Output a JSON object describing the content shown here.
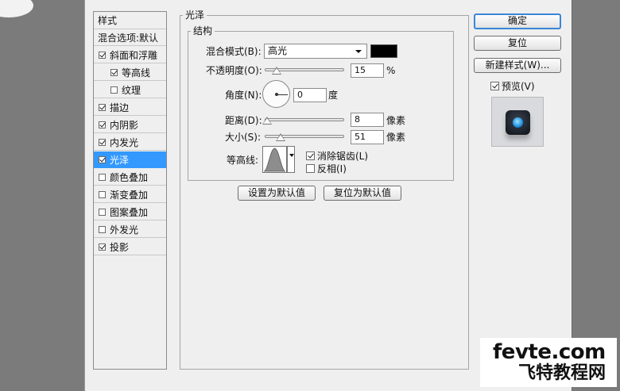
{
  "list": {
    "header": "样式",
    "items": [
      {
        "label": "混合选项:默认",
        "checkbox": false,
        "checked": false,
        "indent": false,
        "selected": false
      },
      {
        "label": "斜面和浮雕",
        "checkbox": true,
        "checked": true,
        "indent": false,
        "selected": false
      },
      {
        "label": "等高线",
        "checkbox": true,
        "checked": true,
        "indent": true,
        "selected": false
      },
      {
        "label": "纹理",
        "checkbox": true,
        "checked": false,
        "indent": true,
        "selected": false
      },
      {
        "label": "描边",
        "checkbox": true,
        "checked": true,
        "indent": false,
        "selected": false
      },
      {
        "label": "内阴影",
        "checkbox": true,
        "checked": true,
        "indent": false,
        "selected": false
      },
      {
        "label": "内发光",
        "checkbox": true,
        "checked": true,
        "indent": false,
        "selected": false
      },
      {
        "label": "光泽",
        "checkbox": true,
        "checked": true,
        "indent": false,
        "selected": true
      },
      {
        "label": "颜色叠加",
        "checkbox": true,
        "checked": false,
        "indent": false,
        "selected": false
      },
      {
        "label": "渐变叠加",
        "checkbox": true,
        "checked": false,
        "indent": false,
        "selected": false
      },
      {
        "label": "图案叠加",
        "checkbox": true,
        "checked": false,
        "indent": false,
        "selected": false
      },
      {
        "label": "外发光",
        "checkbox": true,
        "checked": false,
        "indent": false,
        "selected": false
      },
      {
        "label": "投影",
        "checkbox": true,
        "checked": true,
        "indent": false,
        "selected": false
      }
    ]
  },
  "satin": {
    "title": "光泽",
    "structure_title": "结构",
    "blend_mode_label": "混合模式(B):",
    "blend_mode_value": "高光",
    "blend_color": "#000000",
    "opacity_label": "不透明度(O):",
    "opacity_value": "15",
    "opacity_unit": "%",
    "opacity_fraction": 0.15,
    "angle_label": "角度(N):",
    "angle_value": "0",
    "angle_unit": "度",
    "distance_label": "距离(D):",
    "distance_value": "8",
    "distance_unit": "像素",
    "distance_fraction": 0.03,
    "size_label": "大小(S):",
    "size_value": "51",
    "size_unit": "像素",
    "size_fraction": 0.2,
    "contour_label": "等高线:",
    "antialias_label": "消除锯齿(L)",
    "antialias_checked": true,
    "invert_label": "反相(I)",
    "invert_checked": false,
    "make_default_label": "设置为默认值",
    "reset_default_label": "复位为默认值"
  },
  "buttons": {
    "ok": "确定",
    "reset": "复位",
    "new_style": "新建样式(W)...",
    "preview_label": "预览(V)",
    "preview_checked": true
  },
  "watermark": {
    "line1": "fevte.com",
    "line2": "飞特教程网"
  },
  "colors": {
    "selection": "#3399ff",
    "default_button_border": "#3a86d6"
  }
}
